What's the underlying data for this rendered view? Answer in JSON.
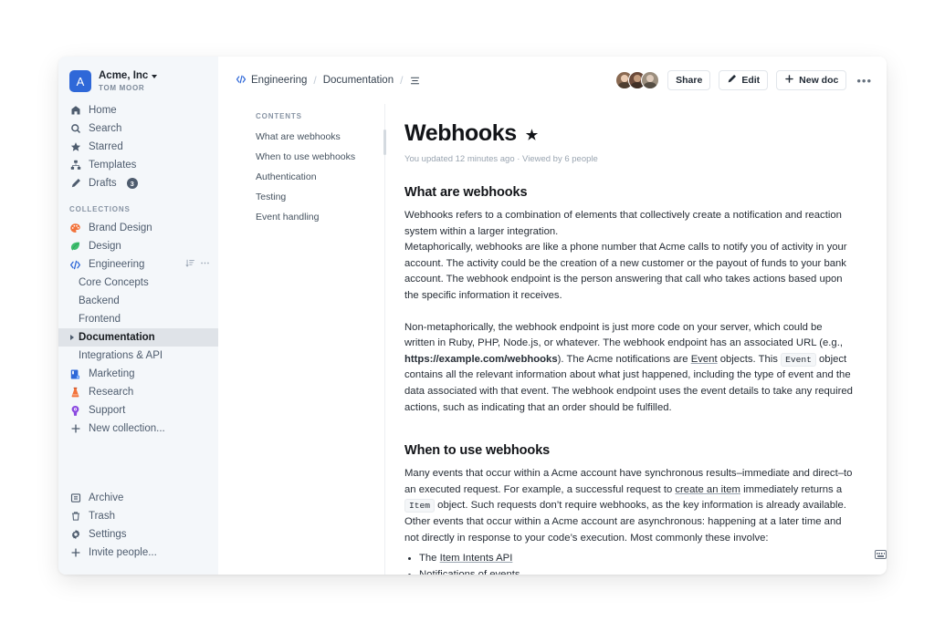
{
  "sidebar": {
    "team": {
      "logo_letter": "A",
      "name": "Acme, Inc",
      "user": "TOM MOOR",
      "caret_icon": "chevron-down-icon"
    },
    "nav": [
      {
        "label": "Home",
        "icon": "home-icon"
      },
      {
        "label": "Search",
        "icon": "search-icon"
      },
      {
        "label": "Starred",
        "icon": "star-icon"
      },
      {
        "label": "Templates",
        "icon": "templates-icon"
      },
      {
        "label": "Drafts",
        "icon": "pencil-icon",
        "badge": "3"
      }
    ],
    "collections_label": "COLLECTIONS",
    "collections": [
      {
        "label": "Brand Design",
        "icon": "palette-icon",
        "color": "#f2733b"
      },
      {
        "label": "Design",
        "icon": "leaf-icon",
        "color": "#3fbe6f"
      },
      {
        "label": "Engineering",
        "icon": "code-icon",
        "color": "#2f68d8",
        "expanded": true,
        "actions": {
          "sort_icon": "sort-icon",
          "more_icon": "more-horizontal-icon"
        },
        "documents": [
          {
            "label": "Core Concepts",
            "selected": false
          },
          {
            "label": "Backend",
            "selected": false
          },
          {
            "label": "Frontend",
            "selected": false
          },
          {
            "label": "Documentation",
            "selected": true
          },
          {
            "label": "Integrations & API",
            "selected": false
          }
        ]
      },
      {
        "label": "Marketing",
        "icon": "book-icon",
        "color": "#2f68d8"
      },
      {
        "label": "Research",
        "icon": "beaker-icon",
        "color": "#f2733b"
      },
      {
        "label": "Support",
        "icon": "lifebuoy-icon",
        "color": "#8b4ae0"
      },
      {
        "label": "New collection...",
        "icon": "plus-icon",
        "color": "#4e5c6e"
      }
    ],
    "bottom": [
      {
        "label": "Archive",
        "icon": "archive-icon"
      },
      {
        "label": "Trash",
        "icon": "trash-icon"
      },
      {
        "label": "Settings",
        "icon": "gear-icon"
      },
      {
        "label": "Invite people...",
        "icon": "plus-icon"
      }
    ]
  },
  "topbar": {
    "breadcrumb": {
      "collection_icon": "code-icon",
      "collection": "Engineering",
      "document": "Documentation",
      "separator": "/",
      "menu_icon": "list-menu-icon"
    },
    "collaborators_count": 3,
    "share_label": "Share",
    "edit_label": "Edit",
    "edit_icon": "pencil-icon",
    "new_doc_label": "New doc",
    "new_doc_icon": "plus-icon",
    "more_label": "•••"
  },
  "contents": {
    "heading": "CONTENTS",
    "items": [
      "What are webhooks",
      "When to use webhooks",
      "Authentication",
      "Testing",
      "Event handling"
    ]
  },
  "document": {
    "title": "Webhooks",
    "starred_icon": "star-filled-icon",
    "meta": "You updated 12 minutes ago · Viewed by 6 people",
    "sections": [
      {
        "heading": "What are webhooks",
        "paragraph_1": "Webhooks refers to a combination of elements that collectively create a notification and reaction system within a larger integration.",
        "paragraph_2": "Metaphorically, webhooks are like a phone number that Acme calls to notify you of activity in your account. The activity could be the creation of a new customer or the payout of funds to your bank account. The webhook endpoint is the person answering that call who takes actions based upon the specific information it receives.",
        "paragraph_3_a": "Non-metaphorically, the webhook endpoint is just more code on your server, which could be written in Ruby, PHP, Node.js, or whatever. The webhook endpoint has an associated URL (e.g., ",
        "paragraph_3_url": "https://example.com/webhooks",
        "paragraph_3_b": "). The Acme notifications are ",
        "paragraph_3_link": "Event",
        "paragraph_3_c": " objects. This ",
        "paragraph_3_code": "Event",
        "paragraph_3_d": " object contains all the relevant information about what just happened, including the type of event and the data associated with that event. The webhook endpoint uses the event details to take any required actions, such as indicating that an order should be fulfilled."
      },
      {
        "heading": "When to use webhooks",
        "paragraph_1_a": "Many events that occur within a Acme account have synchronous results–immediate and direct–to an executed request. For example, a successful request to ",
        "paragraph_1_link": "create an item",
        "paragraph_1_b": " immediately returns a ",
        "paragraph_1_code": "Item",
        "paragraph_1_c": " object. Such requests don’t require webhooks, as the key information is already available. Other events that occur within a Acme account are asynchronous: happening at a later time and not directly in response to your code’s execution. Most commonly these involve:",
        "bullet_1_prefix": "The ",
        "bullet_1_link": "Item Intents API",
        "bullet_2": "Notifications of events"
      }
    ],
    "keyboard_shortcut_icon": "keyboard-icon"
  }
}
